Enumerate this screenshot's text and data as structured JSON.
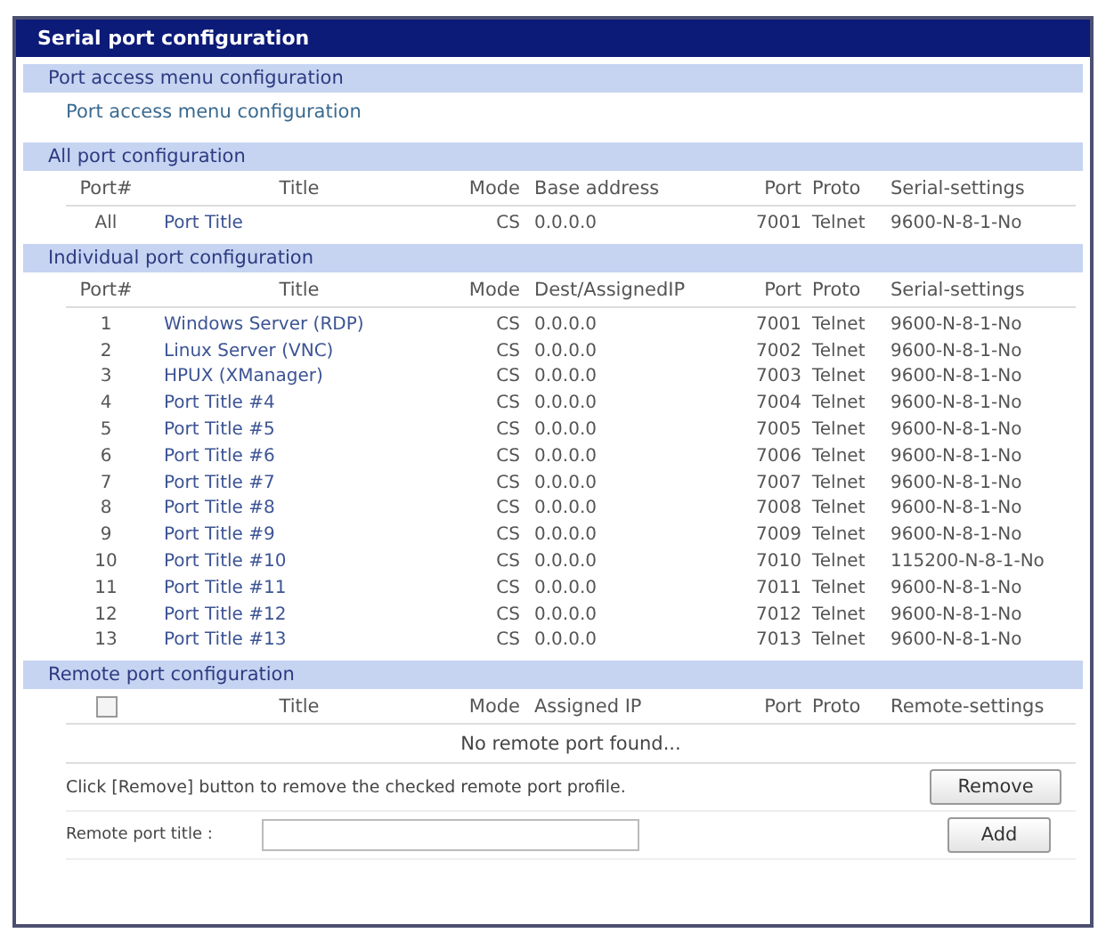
{
  "window": {
    "title": "Serial port configuration"
  },
  "port_access_menu": {
    "heading": "Port access menu configuration",
    "link": "Port access menu configuration"
  },
  "all_port": {
    "heading": "All port configuration",
    "columns": [
      "Port#",
      "Title",
      "Mode",
      "Base address",
      "Port",
      "Proto",
      "Serial-settings"
    ],
    "rows": [
      {
        "port": "All",
        "title": "Port Title",
        "mode": "CS",
        "address": "0.0.0.0",
        "tcp_port": "7001",
        "proto": "Telnet",
        "settings": "9600-N-8-1-No"
      }
    ]
  },
  "individual_port": {
    "heading": "Individual port configuration",
    "columns": [
      "Port#",
      "Title",
      "Mode",
      "Dest/AssignedIP",
      "Port",
      "Proto",
      "Serial-settings"
    ],
    "rows": [
      {
        "port": "1",
        "title": "Windows Server (RDP)",
        "mode": "CS",
        "address": "0.0.0.0",
        "tcp_port": "7001",
        "proto": "Telnet",
        "settings": "9600-N-8-1-No"
      },
      {
        "port": "2",
        "title": "Linux Server (VNC)",
        "mode": "CS",
        "address": "0.0.0.0",
        "tcp_port": "7002",
        "proto": "Telnet",
        "settings": "9600-N-8-1-No"
      },
      {
        "port": "3",
        "title": "HPUX (XManager)",
        "mode": "CS",
        "address": "0.0.0.0",
        "tcp_port": "7003",
        "proto": "Telnet",
        "settings": "9600-N-8-1-No"
      },
      {
        "port": "4",
        "title": "Port Title #4",
        "mode": "CS",
        "address": "0.0.0.0",
        "tcp_port": "7004",
        "proto": "Telnet",
        "settings": "9600-N-8-1-No"
      },
      {
        "port": "5",
        "title": "Port Title #5",
        "mode": "CS",
        "address": "0.0.0.0",
        "tcp_port": "7005",
        "proto": "Telnet",
        "settings": "9600-N-8-1-No"
      },
      {
        "port": "6",
        "title": "Port Title #6",
        "mode": "CS",
        "address": "0.0.0.0",
        "tcp_port": "7006",
        "proto": "Telnet",
        "settings": "9600-N-8-1-No"
      },
      {
        "port": "7",
        "title": "Port Title #7",
        "mode": "CS",
        "address": "0.0.0.0",
        "tcp_port": "7007",
        "proto": "Telnet",
        "settings": "9600-N-8-1-No"
      },
      {
        "port": "8",
        "title": "Port Title #8",
        "mode": "CS",
        "address": "0.0.0.0",
        "tcp_port": "7008",
        "proto": "Telnet",
        "settings": "9600-N-8-1-No"
      },
      {
        "port": "9",
        "title": "Port Title #9",
        "mode": "CS",
        "address": "0.0.0.0",
        "tcp_port": "7009",
        "proto": "Telnet",
        "settings": "9600-N-8-1-No"
      },
      {
        "port": "10",
        "title": "Port Title #10",
        "mode": "CS",
        "address": "0.0.0.0",
        "tcp_port": "7010",
        "proto": "Telnet",
        "settings": "115200-N-8-1-No"
      },
      {
        "port": "11",
        "title": "Port Title #11",
        "mode": "CS",
        "address": "0.0.0.0",
        "tcp_port": "7011",
        "proto": "Telnet",
        "settings": "9600-N-8-1-No"
      },
      {
        "port": "12",
        "title": "Port Title #12",
        "mode": "CS",
        "address": "0.0.0.0",
        "tcp_port": "7012",
        "proto": "Telnet",
        "settings": "9600-N-8-1-No"
      },
      {
        "port": "13",
        "title": "Port Title #13",
        "mode": "CS",
        "address": "0.0.0.0",
        "tcp_port": "7013",
        "proto": "Telnet",
        "settings": "9600-N-8-1-No"
      }
    ]
  },
  "remote_port": {
    "heading": "Remote port configuration",
    "select_all_checked": false,
    "columns": [
      "Title",
      "Mode",
      "Assigned IP",
      "Port",
      "Proto",
      "Remote-settings"
    ],
    "empty_message": "No remote port found...",
    "instruction": "Click [Remove] button to remove the checked remote port profile.",
    "remove_button": "Remove",
    "title_label": "Remote port title :",
    "add_button": "Add"
  }
}
